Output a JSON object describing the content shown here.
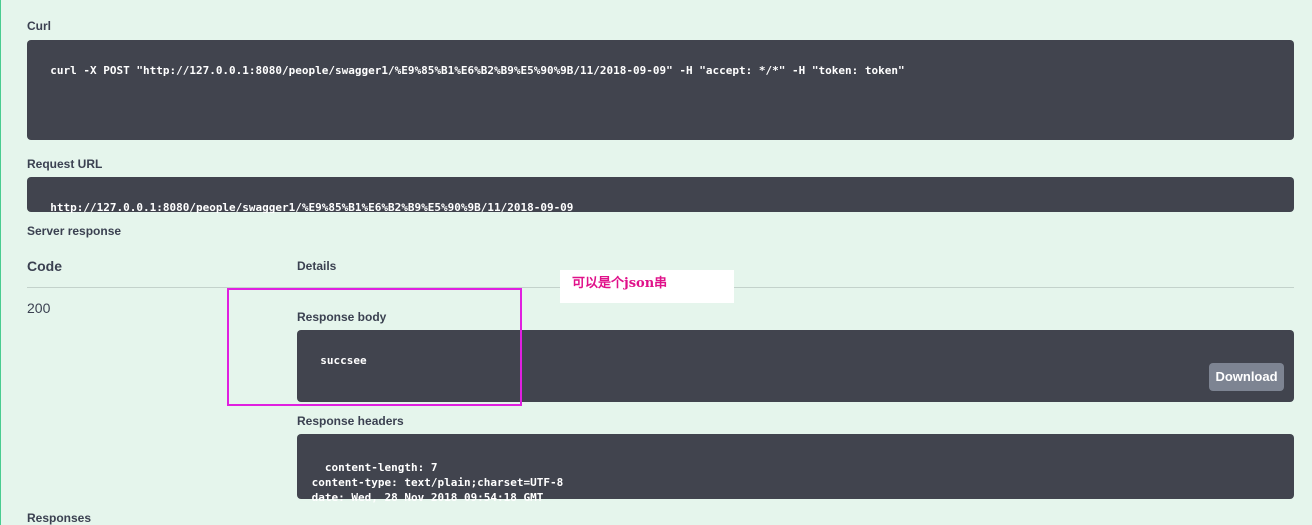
{
  "curl": {
    "label": "Curl",
    "command": "curl -X POST \"http://127.0.0.1:8080/people/swagger1/%E9%85%B1%E6%B2%B9%E5%90%9B/11/2018-09-09\" -H \"accept: */*\" -H \"token: token\""
  },
  "request_url": {
    "label": "Request URL",
    "value": "http://127.0.0.1:8080/people/swagger1/%E9%85%B1%E6%B2%B9%E5%90%9B/11/2018-09-09"
  },
  "server_response": {
    "label": "Server response",
    "code_header": "Code",
    "details_header": "Details",
    "code": "200",
    "response_body_label": "Response body",
    "response_body": "succsee",
    "download_label": "Download",
    "response_headers_label": "Response headers",
    "response_headers": " content-length: 7 \n content-type: text/plain;charset=UTF-8 \n date: Wed, 28 Nov 2018 09:54:18 GMT "
  },
  "responses": {
    "label": "Responses"
  },
  "annotation": {
    "note": "可以是个json串",
    "color": "#e020e0"
  }
}
